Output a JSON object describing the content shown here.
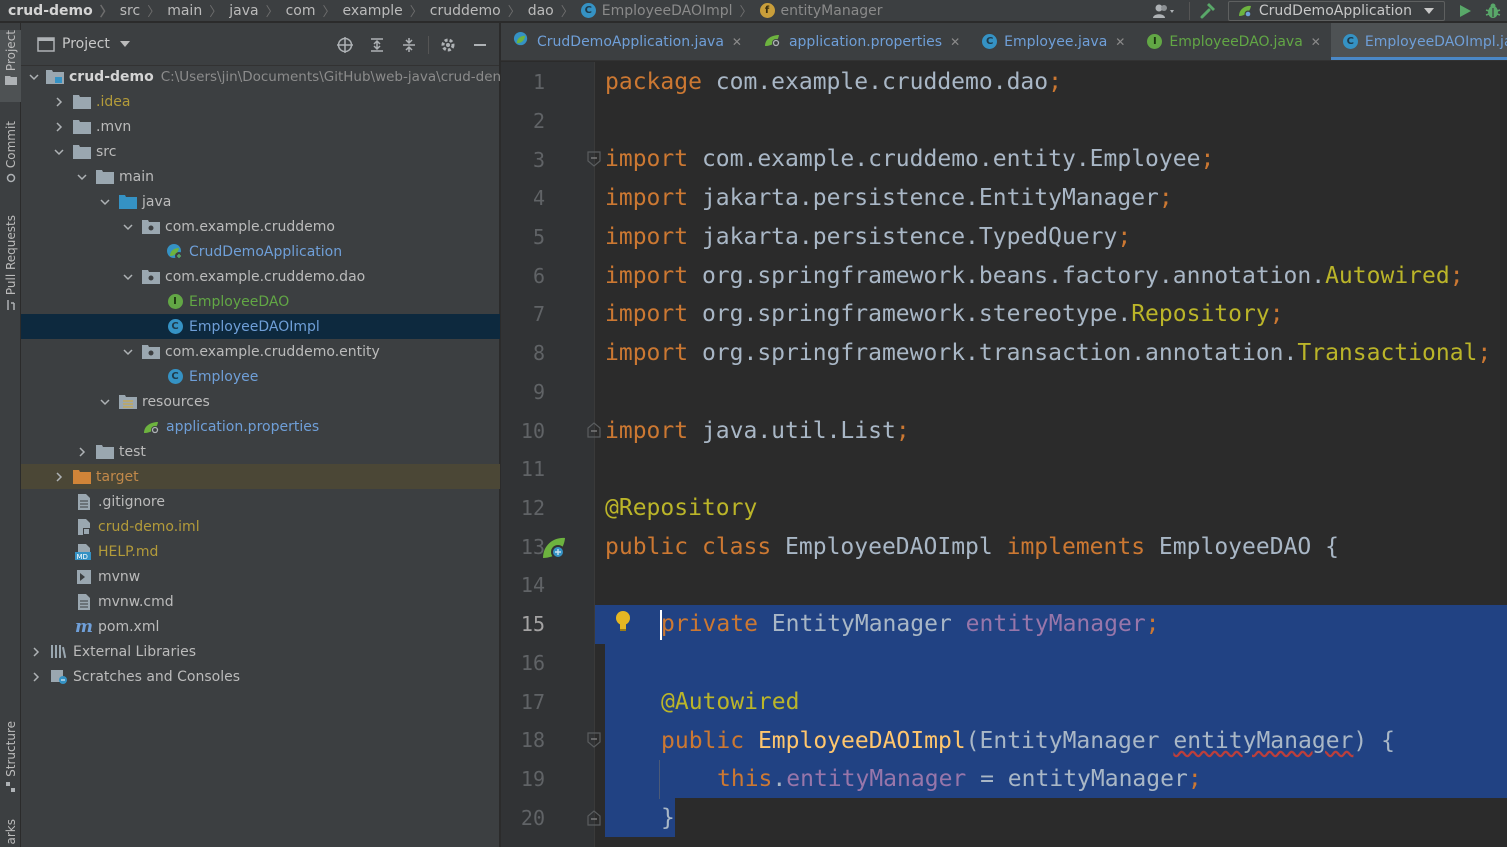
{
  "breadcrumb": {
    "items": [
      "crud-demo",
      "src",
      "main",
      "java",
      "com",
      "example",
      "cruddemo",
      "dao",
      "EmployeeDAOImpl",
      "entityManager"
    ]
  },
  "toolbar": {
    "run_config": "CrudDemoApplication"
  },
  "stripe": {
    "project": "Project",
    "commit": "Commit",
    "pull_requests": "Pull Requests",
    "structure": "Structure",
    "bookmarks": "arks"
  },
  "project_panel": {
    "title": "Project",
    "root_name": "crud-demo",
    "root_path": "C:\\Users\\jin\\Documents\\GitHub\\web-java\\crud-den",
    "items": [
      {
        "label": ".idea"
      },
      {
        "label": ".mvn"
      },
      {
        "label": "src"
      },
      {
        "label": "main"
      },
      {
        "label": "java"
      },
      {
        "label": "com.example.cruddemo"
      },
      {
        "label": "CrudDemoApplication"
      },
      {
        "label": "com.example.cruddemo.dao"
      },
      {
        "label": "EmployeeDAO"
      },
      {
        "label": "EmployeeDAOImpl"
      },
      {
        "label": "com.example.cruddemo.entity"
      },
      {
        "label": "Employee"
      },
      {
        "label": "resources"
      },
      {
        "label": "application.properties"
      },
      {
        "label": "test"
      },
      {
        "label": "target"
      },
      {
        "label": ".gitignore"
      },
      {
        "label": "crud-demo.iml"
      },
      {
        "label": "HELP.md"
      },
      {
        "label": "mvnw"
      },
      {
        "label": "mvnw.cmd"
      },
      {
        "label": "pom.xml"
      },
      {
        "label": "External Libraries"
      },
      {
        "label": "Scratches and Consoles"
      }
    ]
  },
  "tabs": [
    {
      "label": "CrudDemoApplication.java",
      "badge": "C"
    },
    {
      "label": "application.properties",
      "badge": "leaf"
    },
    {
      "label": "Employee.java",
      "badge": "C"
    },
    {
      "label": "EmployeeDAO.java",
      "badge": "I"
    },
    {
      "label": "EmployeeDAOImpl.java",
      "badge": "C"
    }
  ],
  "editor": {
    "line_numbers": [
      "1",
      "2",
      "3",
      "4",
      "5",
      "6",
      "7",
      "8",
      "9",
      "10",
      "11",
      "12",
      "13",
      "14",
      "15",
      "16",
      "17",
      "18",
      "19",
      "20"
    ],
    "code": {
      "l1_kw": "package",
      "l1_rest": " com.example.cruddemo.dao",
      "semi": ";",
      "l3_rest": " com.example.cruddemo.entity.Employee",
      "l4_rest": " jakarta.persistence.EntityManager",
      "l5_rest": " jakarta.persistence.TypedQuery",
      "l6_pkg": " org.springframework.beans.factory.annotation.",
      "l6_cls": "Autowired",
      "l7_pkg": " org.springframework.stereotype.",
      "l7_cls": "Repository",
      "l8_pkg": " org.springframework.transaction.annotation.",
      "l8_cls": "Transactional",
      "l10_rest": " java.util.List",
      "import": "import",
      "l12_ann": "@Repository",
      "l13_public": "public",
      "l13_class": " class",
      "l13_name": " EmployeeDAOImpl",
      "l13_impl": " implements",
      "l13_iface": " EmployeeDAO {",
      "l15_private": "private",
      "l15_type": " EntityManager ",
      "l15_field": "entityManager",
      "l17_ann": "@Autowired",
      "l18_public": "public",
      "l18_name": " EmployeeDAOImpl",
      "l18_open": "(EntityManager ",
      "l18_param": "entityManager",
      "l18_close": ") {",
      "l19_this": "this",
      "l19_dot": ".",
      "l19_field": "entityManager",
      "l19_assign": " = entityManager",
      "l20_brace": "}"
    }
  },
  "colors": {
    "keyword": "#cc7832",
    "annotation": "#bbb529",
    "field": "#9876aa",
    "method": "#ffc66d",
    "selection": "#214283"
  }
}
